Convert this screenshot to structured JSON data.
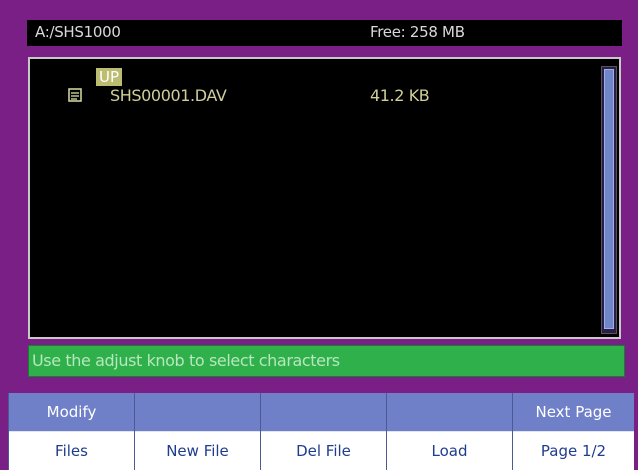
{
  "topbar": {
    "path": "A:/SHS1000",
    "free": "Free: 258 MB"
  },
  "filelist": {
    "up_label": "UP",
    "items": [
      {
        "name": "SHS00001.DAV",
        "size": "41.2 KB",
        "icon": "file-icon"
      }
    ]
  },
  "status": {
    "message": "Use the adjust knob to select characters"
  },
  "softkeys": [
    {
      "top": "Modify",
      "bottom": "Files"
    },
    {
      "top": "",
      "bottom": "New File"
    },
    {
      "top": "",
      "bottom": "Del File"
    },
    {
      "top": "",
      "bottom": "Load"
    },
    {
      "top": "Next Page",
      "bottom": "Page 1/2"
    }
  ],
  "colors": {
    "frame": "#7a1f86",
    "status_bg": "#2fb04a",
    "softkey_top": "#6f7fc8",
    "highlight": "#bdbd72"
  }
}
